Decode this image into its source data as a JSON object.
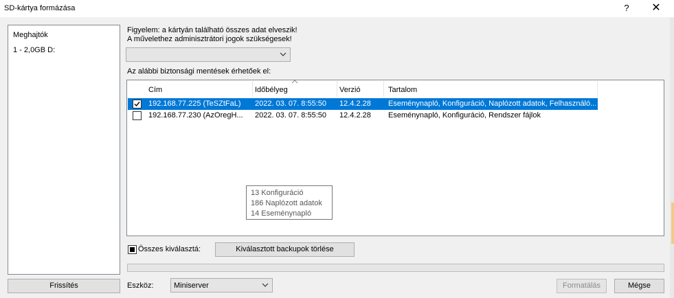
{
  "window": {
    "title": "SD-kártya formázása",
    "help_label": "?",
    "close_label": "✕"
  },
  "drives": {
    "header": "Meghajtók",
    "items": [
      "1 - 2,0GB  D:"
    ]
  },
  "warning": {
    "line1": "Figyelem: a kártyán található összes adat elveszik!",
    "line2": "A művelethez adminisztrátori jogok szükségesek!"
  },
  "backups": {
    "label": "Az alábbi biztonsági mentések érhetőek el:",
    "columns": [
      "Cím",
      "Időbélyeg",
      "Verzió",
      "Tartalom"
    ],
    "rows": [
      {
        "checked": true,
        "selected": true,
        "address": "192.168.77.225 (TeSZtFaL)",
        "timestamp": "2022. 03. 07. 8:55:50",
        "version": "12.4.2.28",
        "content": "Eseménynapló, Konfiguráció, Naplózott adatok, Felhasználó..."
      },
      {
        "checked": false,
        "selected": false,
        "address": "192.168.77.230 (AzOregH...",
        "timestamp": "2022. 03. 07. 8:55:50",
        "version": "12.4.2.28",
        "content": "Eseménynapló, Konfiguráció, Rendszer fájlok"
      }
    ]
  },
  "tooltip": {
    "lines": [
      "13 Konfiguráció",
      "186 Naplózott adatok",
      "14 Eseménynapló"
    ]
  },
  "select_all": {
    "label": "Összes kiválasztá:",
    "checked": "indeterminate"
  },
  "buttons": {
    "delete": "Kiválasztott backupok törlése",
    "refresh": "Frissítés",
    "format": "Formatálás",
    "cancel": "Mégse"
  },
  "device": {
    "label": "Eszköz:",
    "value": "Miniserver"
  },
  "colors": {
    "selection": "#0078d7",
    "accent_strip": "#f3c98b"
  },
  "icons": {
    "close": "close-icon",
    "dropdown": "chevron-down-icon",
    "sort": "sort-up-icon",
    "check": "check-icon"
  }
}
